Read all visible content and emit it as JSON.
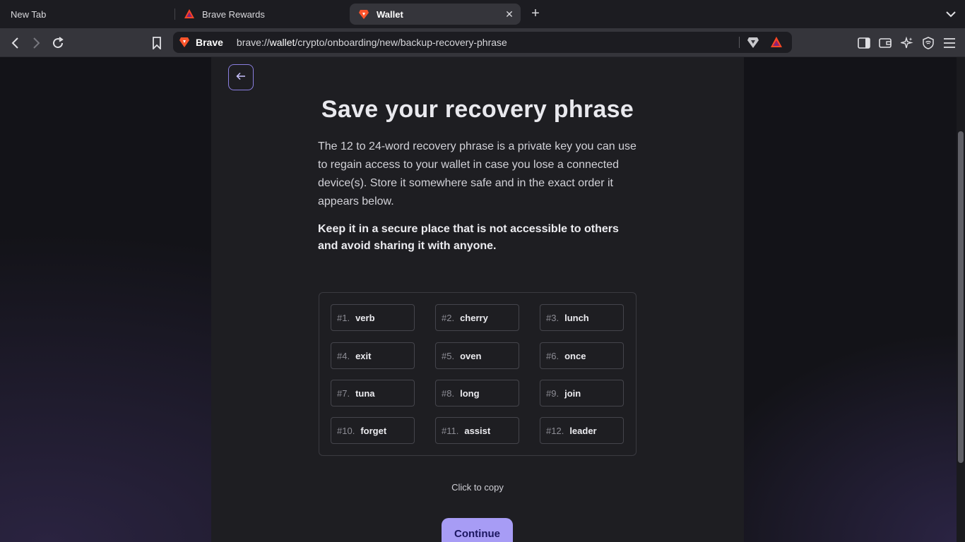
{
  "tabs": [
    {
      "label": "New Tab",
      "active": false
    },
    {
      "label": "Brave Rewards",
      "active": false
    },
    {
      "label": "Wallet",
      "active": true
    }
  ],
  "toolbar": {
    "site_name": "Brave",
    "url_prefix": "brave://",
    "url_host": "wallet",
    "url_path": "/crypto/onboarding/new/backup-recovery-phrase"
  },
  "page": {
    "title": "Save your recovery phrase",
    "description": "The 12 to 24-word recovery phrase is a private key you can use to regain access to your wallet in case you lose a connected device(s). Store it somewhere safe and in the exact order it appears below.",
    "warning": "Keep it in a secure place that is not accessible to others and avoid sharing it with anyone.",
    "words": [
      {
        "num": "#1.",
        "word": "verb"
      },
      {
        "num": "#2.",
        "word": "cherry"
      },
      {
        "num": "#3.",
        "word": "lunch"
      },
      {
        "num": "#4.",
        "word": "exit"
      },
      {
        "num": "#5.",
        "word": "oven"
      },
      {
        "num": "#6.",
        "word": "once"
      },
      {
        "num": "#7.",
        "word": "tuna"
      },
      {
        "num": "#8.",
        "word": "long"
      },
      {
        "num": "#9.",
        "word": "join"
      },
      {
        "num": "#10.",
        "word": "forget"
      },
      {
        "num": "#11.",
        "word": "assist"
      },
      {
        "num": "#12.",
        "word": "leader"
      }
    ],
    "copy_hint": "Click to copy",
    "continue_label": "Continue"
  },
  "colors": {
    "accent": "#a79cf5",
    "background": "#1e1e22"
  }
}
